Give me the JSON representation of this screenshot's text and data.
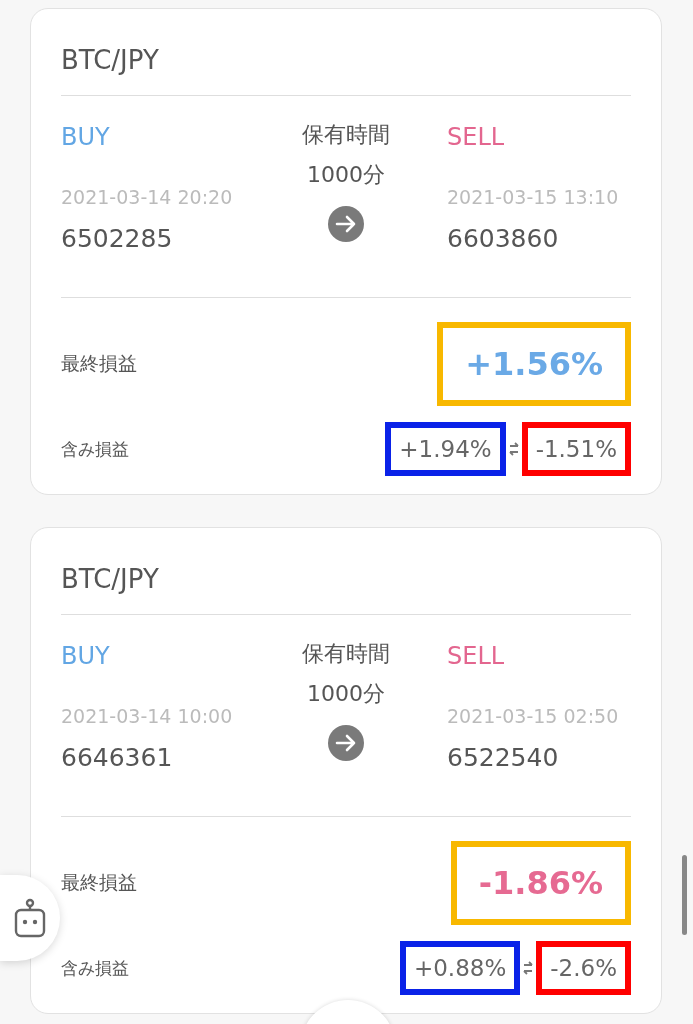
{
  "trades": [
    {
      "pair": "BTC/JPY",
      "buy": {
        "label": "BUY",
        "time": "2021-03-14 20:20",
        "price": "6502285"
      },
      "holding": {
        "label": "保有時間",
        "value": "1000分"
      },
      "sell": {
        "label": "SELL",
        "time": "2021-03-15 13:10",
        "price": "6603860"
      },
      "final": {
        "label": "最終損益",
        "value": "+1.56%",
        "color": "#6aa9e6",
        "frame": {
          "color": "#f8b800"
        }
      },
      "unrealized": {
        "label": "含み損益",
        "high": {
          "value": "+1.94%",
          "frame": {
            "color": "#0a22e8"
          }
        },
        "low": {
          "value": "-1.51%",
          "frame": {
            "color": "#ff0000"
          }
        }
      }
    },
    {
      "pair": "BTC/JPY",
      "buy": {
        "label": "BUY",
        "time": "2021-03-14 10:00",
        "price": "6646361"
      },
      "holding": {
        "label": "保有時間",
        "value": "1000分"
      },
      "sell": {
        "label": "SELL",
        "time": "2021-03-15 02:50",
        "price": "6522540"
      },
      "final": {
        "label": "最終損益",
        "value": "-1.86%",
        "color": "#e66a92",
        "frame": {
          "color": "#f8b800"
        }
      },
      "unrealized": {
        "label": "含み損益",
        "high": {
          "value": "+0.88%",
          "frame": {
            "color": "#0a22e8"
          }
        },
        "low": {
          "value": "-2.6%",
          "frame": {
            "color": "#ff0000"
          }
        }
      }
    }
  ]
}
